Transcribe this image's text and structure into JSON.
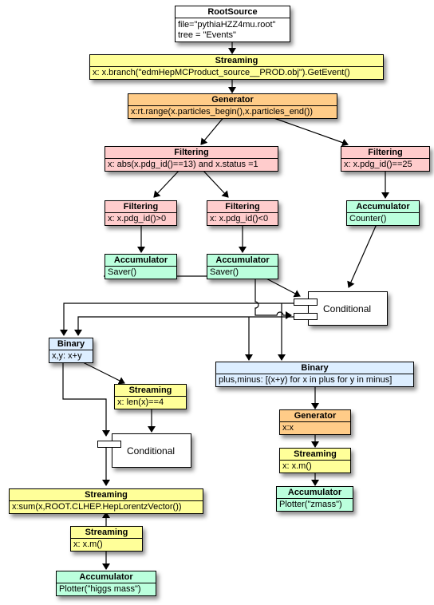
{
  "colors": {
    "source": "#ffffff",
    "streaming": "#ffff99",
    "generator": "#ffcc88",
    "filtering": "#ffcccc",
    "accumulator": "#bbffdd",
    "binary": "#ddeeff",
    "conditional": "#ffffff"
  },
  "nodes": {
    "root_source": {
      "title": "RootSource",
      "lines": [
        "file=\"pythiaHZZ4mu.root\"",
        "tree = \"Events\""
      ]
    },
    "streaming_event": {
      "title": "Streaming",
      "body": "x: x.branch(\"edmHepMCProduct_source__PROD.obj\").GetEvent()"
    },
    "generator_particles": {
      "title": "Generator",
      "body": "x:rt.range(x.particles_begin(),x.particles_end())"
    },
    "filter_muons": {
      "title": "Filtering",
      "body": "x: abs(x.pdg_id()==13) and x.status =1"
    },
    "filter_higgs": {
      "title": "Filtering",
      "body": "x: x.pdg_id()==25"
    },
    "filter_positive": {
      "title": "Filtering",
      "body": "x: x.pdg_id()>0"
    },
    "filter_negative": {
      "title": "Filtering",
      "body": "x: x.pdg_id()<0"
    },
    "acc_counter": {
      "title": "Accumulator",
      "body": "Counter()"
    },
    "acc_saver_plus": {
      "title": "Accumulator",
      "body": "Saver()"
    },
    "acc_saver_minus": {
      "title": "Accumulator",
      "body": "Saver()"
    },
    "conditional_top": {
      "label": "Conditional"
    },
    "binary_sum": {
      "title": "Binary",
      "body": "x,y: x+y"
    },
    "binary_pairs": {
      "title": "Binary",
      "body": "plus,minus: [(x+y) for x in plus for y in minus]"
    },
    "streaming_len": {
      "title": "Streaming",
      "body": "x: len(x)==4"
    },
    "conditional_bottom": {
      "label": "Conditional"
    },
    "streaming_sum": {
      "title": "Streaming",
      "body": "x:sum(x,ROOT.CLHEP.HepLorentzVector())"
    },
    "streaming_mass_higgs": {
      "title": "Streaming",
      "body": "x: x.m()"
    },
    "acc_plot_higgs": {
      "title": "Accumulator",
      "body": "Plotter(\"higgs mass\")"
    },
    "generator_identity": {
      "title": "Generator",
      "body": "x:x"
    },
    "streaming_mass_z": {
      "title": "Streaming",
      "body": "x: x.m()"
    },
    "acc_plot_z": {
      "title": "Accumulator",
      "body": "Plotter(\"zmass\")"
    }
  },
  "edges": [
    [
      "root_source",
      "streaming_event"
    ],
    [
      "streaming_event",
      "generator_particles"
    ],
    [
      "generator_particles",
      "filter_muons"
    ],
    [
      "generator_particles",
      "filter_higgs"
    ],
    [
      "filter_muons",
      "filter_positive"
    ],
    [
      "filter_muons",
      "filter_negative"
    ],
    [
      "filter_higgs",
      "acc_counter"
    ],
    [
      "filter_positive",
      "acc_saver_plus"
    ],
    [
      "filter_negative",
      "acc_saver_minus"
    ],
    [
      "acc_counter",
      "conditional_top"
    ],
    [
      "acc_saver_plus",
      "conditional_top"
    ],
    [
      "acc_saver_minus",
      "conditional_top"
    ],
    [
      "conditional_top",
      "binary_sum"
    ],
    [
      "conditional_top",
      "binary_pairs"
    ],
    [
      "binary_sum",
      "streaming_len"
    ],
    [
      "binary_sum",
      "conditional_bottom"
    ],
    [
      "streaming_len",
      "conditional_bottom"
    ],
    [
      "conditional_bottom",
      "streaming_sum"
    ],
    [
      "streaming_mass_higgs",
      "streaming_sum"
    ],
    [
      "streaming_mass_higgs",
      "acc_plot_higgs"
    ],
    [
      "binary_pairs",
      "generator_identity"
    ],
    [
      "generator_identity",
      "streaming_mass_z"
    ],
    [
      "streaming_mass_z",
      "acc_plot_z"
    ]
  ]
}
